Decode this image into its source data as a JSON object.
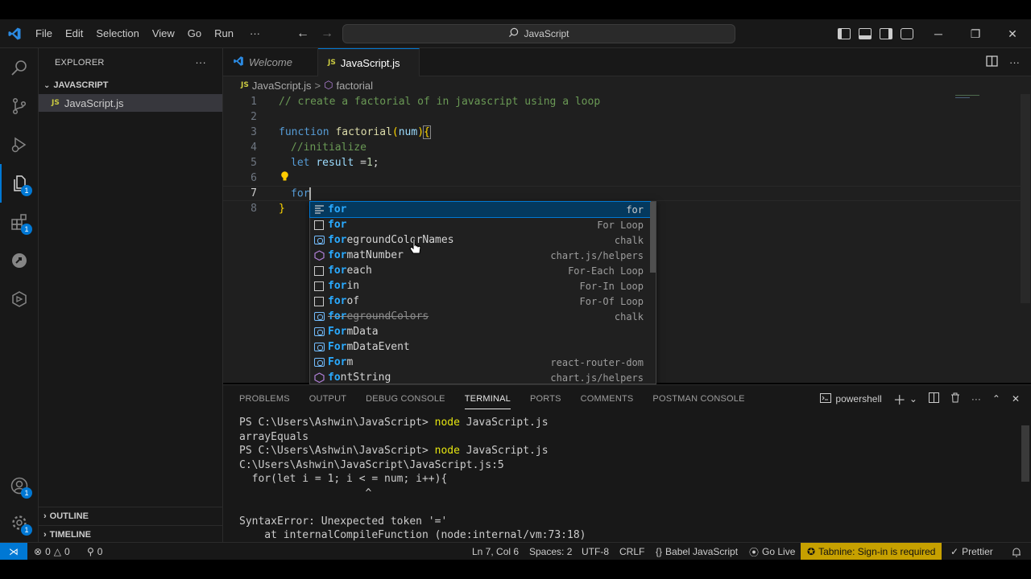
{
  "menu": [
    "File",
    "Edit",
    "Selection",
    "View",
    "Go",
    "Run",
    "···"
  ],
  "command_center": {
    "text": "JavaScript"
  },
  "sidebar": {
    "title": "EXPLORER",
    "more": "···",
    "folder": "JAVASCRIPT",
    "files": [
      {
        "icon": "JS",
        "name": "JavaScript.js"
      }
    ],
    "outline": "OUTLINE",
    "timeline": "TIMELINE"
  },
  "activity_badges": {
    "explorer": "1",
    "extensions": "1",
    "accounts": "1",
    "manage": "1"
  },
  "tabs": [
    {
      "label": "Welcome",
      "active": false
    },
    {
      "label": "JavaScript.js",
      "icon": "JS",
      "active": true,
      "dirty": true
    }
  ],
  "breadcrumb": {
    "file_icon": "JS",
    "file": "JavaScript.js",
    "separator": ">",
    "symbol": "factorial"
  },
  "code_lines": [
    {
      "n": "1",
      "text": "// create a factorial of in javascript using a loop"
    },
    {
      "n": "2",
      "text": ""
    },
    {
      "n": "3",
      "kw": "function",
      "fn": "factorial",
      "param": "num",
      "open": "{"
    },
    {
      "n": "4",
      "text": "//initialize"
    },
    {
      "n": "5",
      "kw": "let",
      "var": "result",
      "op": " =",
      "num": "1",
      "end": ";"
    },
    {
      "n": "6",
      "text": ""
    },
    {
      "n": "7",
      "typed": "for"
    },
    {
      "n": "8",
      "close": "}"
    }
  ],
  "suggestions": [
    {
      "label": "for",
      "match": "for",
      "rest": "",
      "detail": "for",
      "icon": "snippet-icon"
    },
    {
      "label": "for",
      "match": "for",
      "rest": "",
      "detail": "For Loop",
      "icon": "snippet-icon"
    },
    {
      "match": "for",
      "rest": "egroundColorNames",
      "detail": "chalk",
      "icon": "variable-icon"
    },
    {
      "match": "for",
      "rest": "matNumber",
      "detail": "chart.js/helpers",
      "icon": "method-icon"
    },
    {
      "match": "for",
      "rest": "each",
      "detail": "For-Each Loop",
      "icon": "snippet-icon"
    },
    {
      "match": "for",
      "rest": "in",
      "detail": "For-In Loop",
      "icon": "snippet-icon"
    },
    {
      "match": "for",
      "rest": "of",
      "detail": "For-Of Loop",
      "icon": "snippet-icon"
    },
    {
      "match": "for",
      "rest": "egroundColors",
      "detail": "chalk",
      "icon": "variable-icon"
    },
    {
      "match": "For",
      "rest": "mData",
      "detail": "",
      "icon": "variable-icon"
    },
    {
      "match": "For",
      "rest": "mDataEvent",
      "detail": "",
      "icon": "variable-icon"
    },
    {
      "match": "For",
      "rest": "m",
      "detail": "react-router-dom",
      "icon": "variable-icon"
    },
    {
      "match": "fo",
      "rest": "ntString",
      "detail": "chart.js/helpers",
      "icon": "method-icon"
    }
  ],
  "panel": {
    "tabs": [
      "PROBLEMS",
      "OUTPUT",
      "DEBUG CONSOLE",
      "TERMINAL",
      "PORTS",
      "COMMENTS",
      "POSTMAN CONSOLE"
    ],
    "active_tab": "TERMINAL",
    "shell": "powershell"
  },
  "terminal_lines": [
    {
      "prompt": "PS C:\\Users\\Ashwin\\JavaScript> ",
      "cmd": "node",
      "args": " JavaScript.js"
    },
    {
      "text": "arrayEquals"
    },
    {
      "prompt": "PS C:\\Users\\Ashwin\\JavaScript> ",
      "cmd": "node",
      "args": " JavaScript.js"
    },
    {
      "text": "C:\\Users\\Ashwin\\JavaScript\\JavaScript.js:5"
    },
    {
      "text": "  for(let i = 1; i < = num; i++){"
    },
    {
      "text": "                    ^"
    },
    {
      "text": ""
    },
    {
      "text": "SyntaxError: Unexpected token '='"
    },
    {
      "text": "    at internalCompileFunction (node:internal/vm:73:18)"
    }
  ],
  "status": {
    "errors": "0",
    "warnings": "0",
    "ports": "0",
    "position": "Ln 7, Col 6",
    "spaces": "Spaces: 2",
    "encoding": "UTF-8",
    "eol": "CRLF",
    "language": "Babel JavaScript",
    "golive": "Go Live",
    "tabnine": "Tabnine: Sign-in is required",
    "prettier": "Prettier"
  },
  "colors": {
    "accent": "#0078d4",
    "js_icon": "#cbcb41",
    "tabnine_bg": "#c6a000"
  }
}
